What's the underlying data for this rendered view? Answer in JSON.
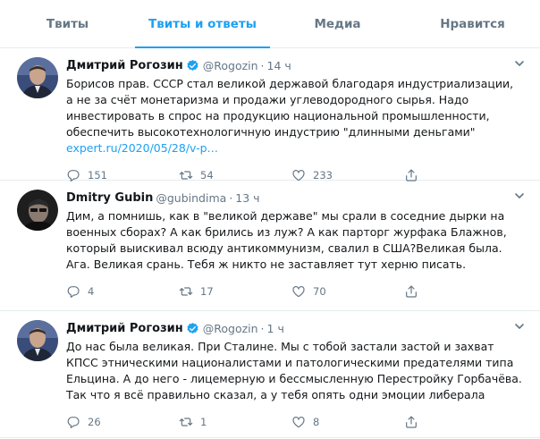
{
  "tabs": [
    {
      "label": "Твиты"
    },
    {
      "label": "Твиты и ответы"
    },
    {
      "label": "Медиа"
    },
    {
      "label": "Нравится"
    }
  ],
  "tweets": [
    {
      "name": "Дмитрий Рогозин",
      "handle": "@Rogozin",
      "dot": "·",
      "time": "14 ч",
      "text": "Борисов прав. СССР стал великой державой благодаря индустриализации, а не за счёт монетаризма и продажи углеводородного сырья. Надо инвестировать в спрос на продукцию национальной промышленности, обеспечить высокотехнологичную индустрию \"длинными деньгами\"",
      "link": "expert.ru/2020/05/28/v-p…",
      "replies": "151",
      "retweets": "54",
      "likes": "233"
    },
    {
      "name": "Dmitry Gubin",
      "handle": "@gubindima",
      "dot": "·",
      "time": "13 ч",
      "text": "Дим, а помнишь, как в \"великой державе\" мы срали в соседние дырки на военных сборах? А как брились из луж? А как парторг журфака Блажнов, который выискивал всюду антикоммунизм, свалил в США?Великая была. Ага. Великая срань. Тебя ж никто не заставляет тут херню писать.",
      "replies": "4",
      "retweets": "17",
      "likes": "70"
    },
    {
      "name": "Дмитрий Рогозин",
      "handle": "@Rogozin",
      "dot": "·",
      "time": "1 ч",
      "text": "До нас была великая. При Сталине. Мы с тобой застали застой и захват КПСС этническими националистами и патологическими предателями типа Ельцина. А до него - лицемерную и бессмысленную Перестройку Горбачёва. Так что я всё правильно сказал, а у тебя опять одни эмоции либерала",
      "replies": "26",
      "retweets": "1",
      "likes": "8"
    }
  ],
  "colors": {
    "accent": "#1da1f2",
    "muted": "#657786",
    "divider": "#e6ecf0",
    "text": "#14171a"
  }
}
